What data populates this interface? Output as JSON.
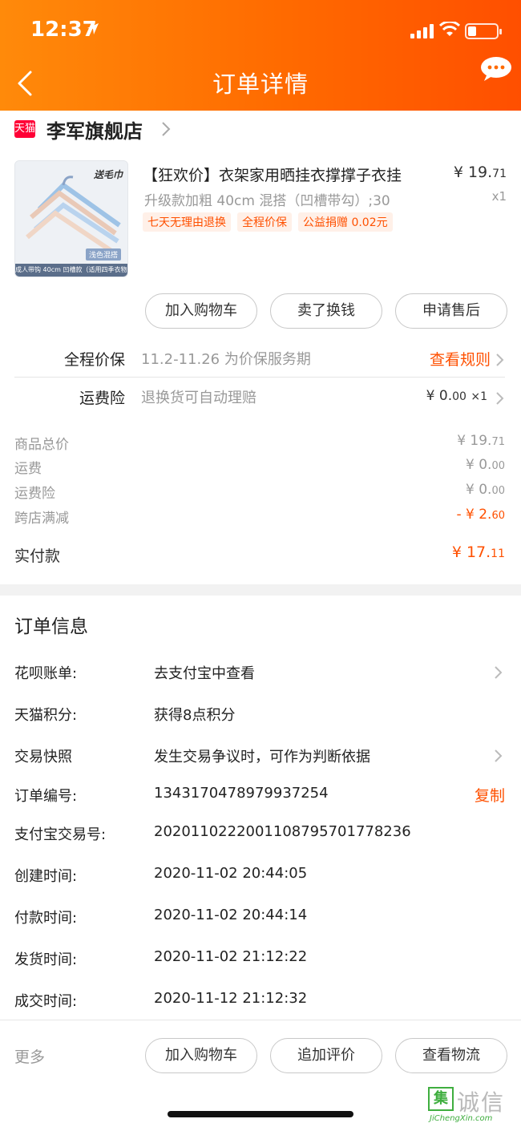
{
  "status_bar": {
    "time": "12:37"
  },
  "header": {
    "title": "订单详情"
  },
  "shop": {
    "badge": "天猫",
    "name": "李军旗舰店"
  },
  "product": {
    "image_tag": "送毛巾",
    "image_tag2": "浅色混搭",
    "image_caption": "成人带钩 40cm 凹槽款（适用四季衣物）",
    "title": "【狂欢价】衣架家用晒挂衣撑撑子衣挂",
    "spec": "升级款加粗 40cm 混搭（凹槽带勾）;30",
    "price_main": "¥ 19.",
    "price_cents": "71",
    "qty": "x1",
    "tags": [
      "七天无理由退换",
      "全程价保",
      "公益捐赠 0.02元"
    ]
  },
  "actions": {
    "add_cart": "加入购物车",
    "resell": "卖了换钱",
    "after_sale": "申请售后"
  },
  "price_protect": {
    "label": "全程价保",
    "value": "11.2-11.26 为价保服务期",
    "link": "查看规则"
  },
  "shipping_insurance": {
    "label": "运费险",
    "value": "退换货可自动理赔",
    "amount_main": "¥ 0.",
    "amount_cents": "00",
    "qty": "×1"
  },
  "summary": {
    "goods_total_label": "商品总价",
    "goods_total_main": "¥ 19.",
    "goods_total_cents": "71",
    "shipping_label": "运费",
    "shipping_main": "¥ 0.",
    "shipping_cents": "00",
    "insurance_label": "运费险",
    "insurance_main": "¥ 0.",
    "insurance_cents": "00",
    "discount_label": "跨店满减",
    "discount_main": "- ¥ 2.",
    "discount_cents": "60",
    "paid_label": "实付款",
    "paid_main": "¥ 17.",
    "paid_cents": "11"
  },
  "order_info": {
    "title": "订单信息",
    "huabei_label": "花呗账单:",
    "huabei_value": "去支付宝中查看",
    "points_label": "天猫积分:",
    "points_value": "获得8点积分",
    "snapshot_label": "交易快照",
    "snapshot_value": "发生交易争议时，可作为判断依据",
    "order_no_label": "订单编号:",
    "order_no_value": "1343170478979937254",
    "copy": "复制",
    "alipay_no_label": "支付宝交易号:",
    "alipay_no_value": "2020110222001108795701778236",
    "created_label": "创建时间:",
    "created_value": "2020-11-02 20:44:05",
    "paid_label": "付款时间:",
    "paid_value": "2020-11-02 20:44:14",
    "shipped_label": "发货时间:",
    "shipped_value": "2020-11-02 21:12:22",
    "closed_label": "成交时间:",
    "closed_value": "2020-11-12 21:12:32"
  },
  "bottom_bar": {
    "more": "更多",
    "add_cart": "加入购物车",
    "add_review": "追加评价",
    "logistics": "查看物流"
  },
  "watermark": {
    "box": "集",
    "text": "诚信",
    "url": "JiChengXin.com"
  },
  "colors": {
    "accent": "#ff5000",
    "header_start": "#ff8a0a",
    "header_end": "#ff4f00",
    "tmall": "#ff0036"
  }
}
